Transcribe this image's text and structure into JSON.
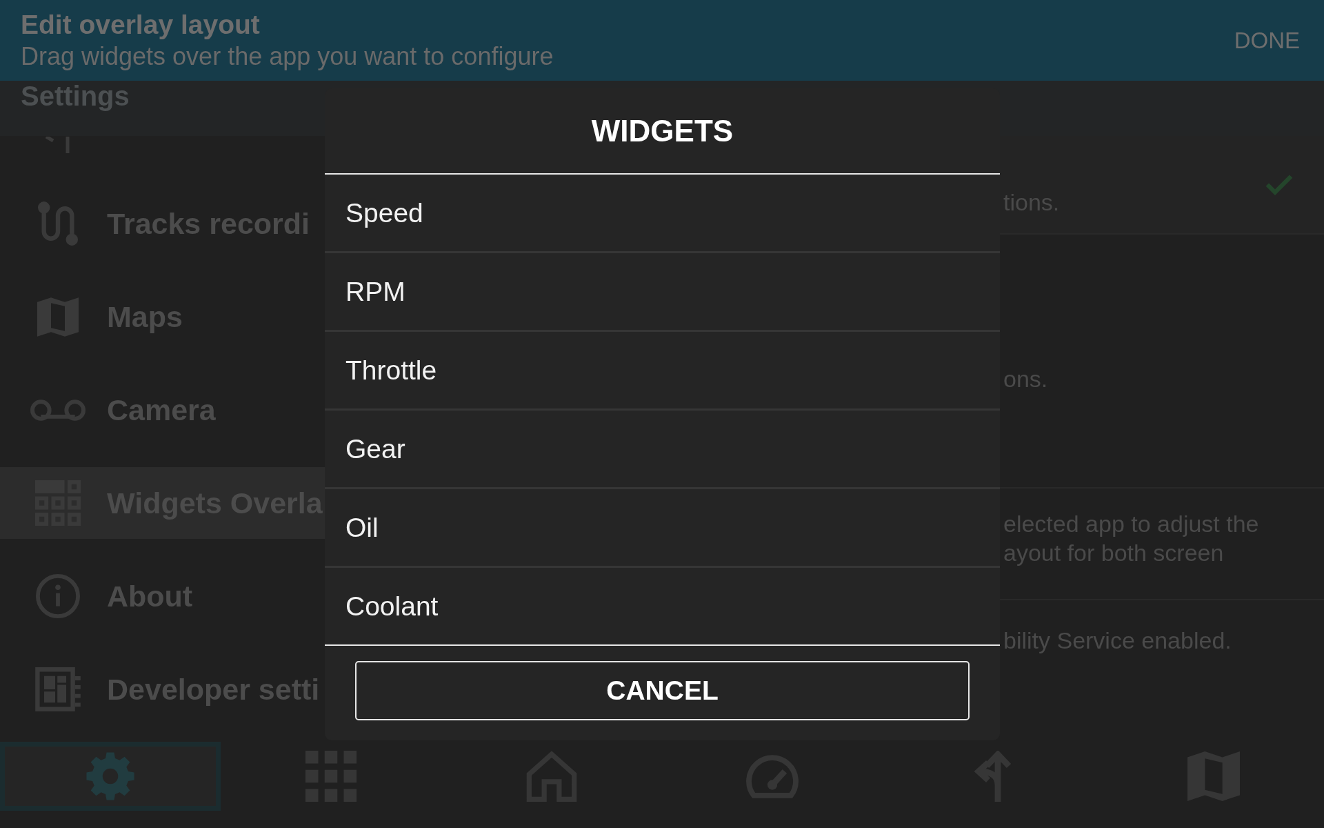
{
  "top_bar": {
    "title": "Edit overlay layout",
    "subtitle": "Drag widgets over the app you want to configure",
    "done_button": "DONE"
  },
  "settings": {
    "title": "Settings",
    "sidebar": {
      "items": [
        {
          "selected": false
        },
        {
          "label": "Tracks recordi",
          "selected": false
        },
        {
          "label": "Maps",
          "selected": false
        },
        {
          "label": "Camera",
          "selected": false
        },
        {
          "label": "Widgets Overla",
          "selected": true
        },
        {
          "label": "About",
          "selected": false
        },
        {
          "label": "Developer setti",
          "selected": false
        }
      ]
    },
    "content_rows": [
      {
        "lines": [
          "tions."
        ],
        "checked": true
      },
      {
        "lines": [
          "ons."
        ],
        "checked": false
      },
      {
        "lines": [
          "elected app to adjust the",
          "ayout for both screen"
        ],
        "checked": false
      },
      {
        "lines": [
          "bility Service enabled."
        ],
        "checked": false
      }
    ]
  },
  "bottom_nav": {
    "tabs": [
      {
        "selected": true
      },
      {
        "selected": false
      },
      {
        "selected": false
      },
      {
        "selected": false
      },
      {
        "selected": false
      },
      {
        "selected": false
      }
    ]
  },
  "dialog": {
    "title": "WIDGETS",
    "options": [
      "Speed",
      "RPM",
      "Throttle",
      "Gear",
      "Oil",
      "Coolant"
    ],
    "cancel_button": "CANCEL"
  }
}
